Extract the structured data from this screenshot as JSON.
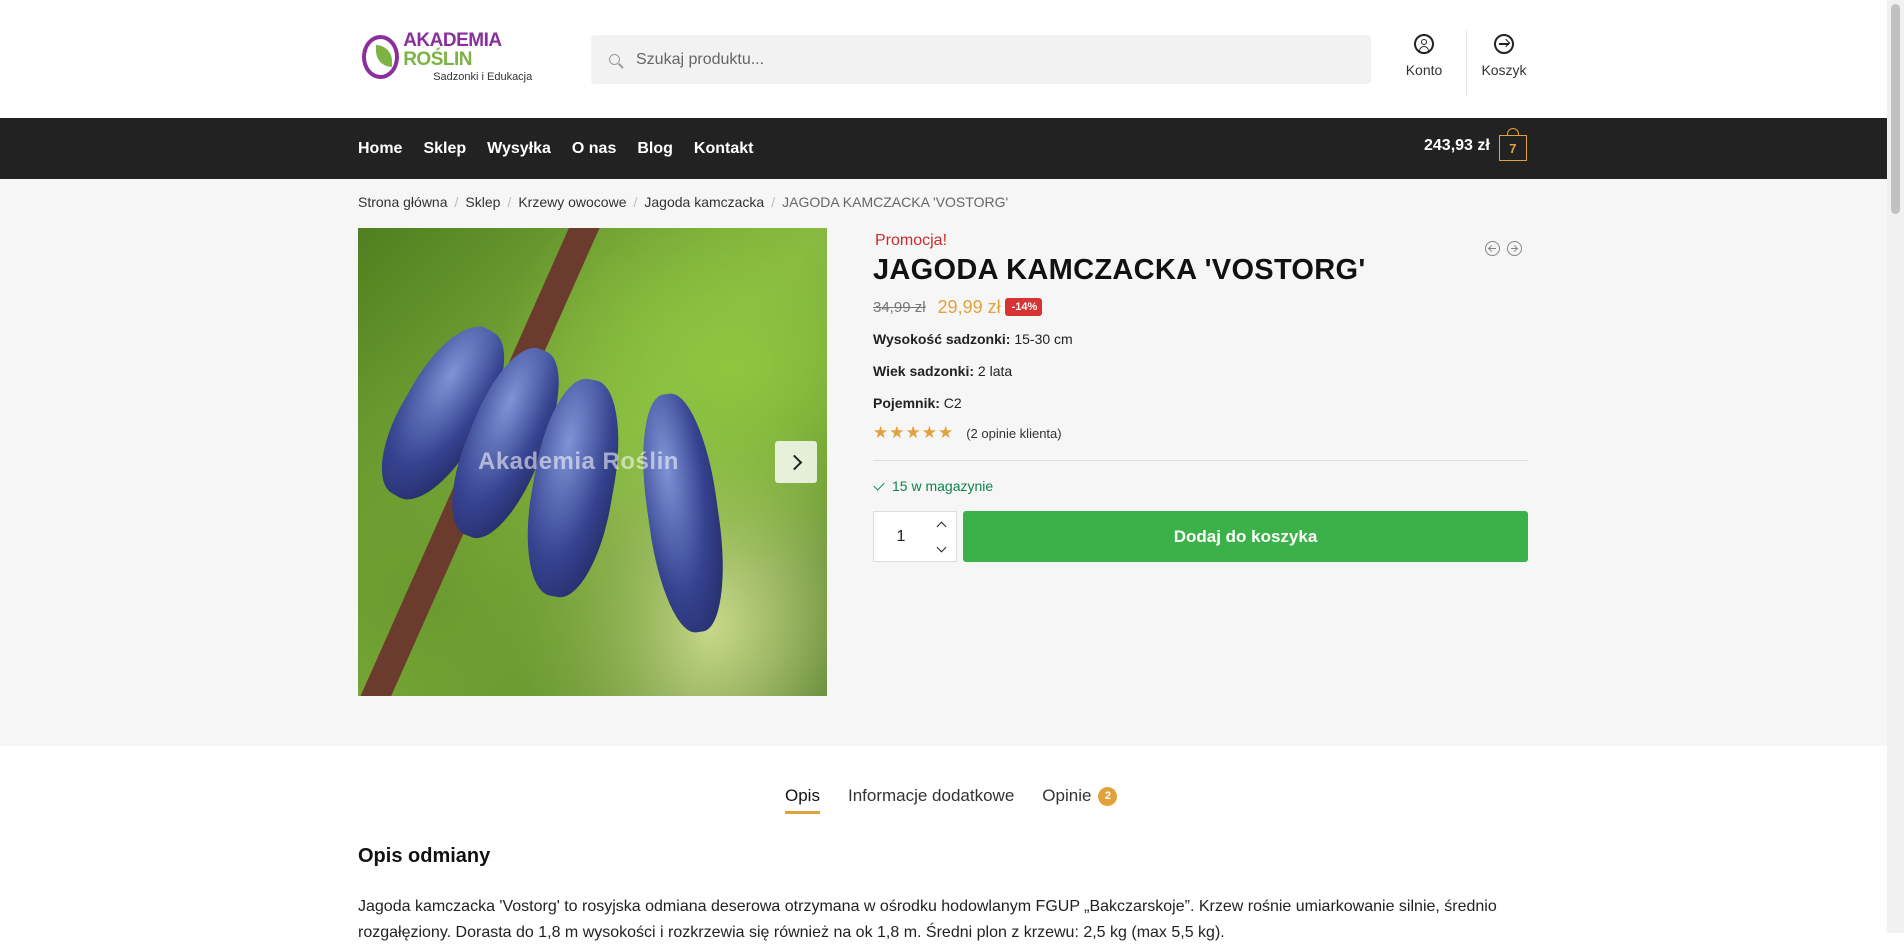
{
  "header": {
    "logo_line1_a": "AKADEMIA",
    "logo_line1_b": "ROŚLIN",
    "logo_line2": "Sadzonki i Edukacja",
    "search_placeholder": "Szukaj produktu...",
    "account_label": "Konto",
    "cart_label": "Koszyk"
  },
  "nav": {
    "items": [
      {
        "label": "Home"
      },
      {
        "label": "Sklep"
      },
      {
        "label": "Wysyłka"
      },
      {
        "label": "O nas"
      },
      {
        "label": "Blog"
      },
      {
        "label": "Kontakt"
      }
    ],
    "cart_total": "243,93 zł",
    "cart_count": "7"
  },
  "breadcrumb": {
    "items": [
      "Strona główna",
      "Sklep",
      "Krzewy owocowe",
      "Jagoda kamczacka"
    ],
    "current": "JAGODA KAMCZACKA 'VOSTORG'"
  },
  "gallery": {
    "watermark": "Akademia Roślin"
  },
  "product": {
    "promo_label": "Promocja!",
    "title": "JAGODA KAMCZACKA 'VOSTORG'",
    "old_price": "34,99 zł",
    "new_price": "29,99 zł",
    "discount": "-14%",
    "attributes": [
      {
        "label": "Wysokość sadzonki:",
        "value": "15-30 cm"
      },
      {
        "label": "Wiek sadzonki:",
        "value": "2 lata"
      },
      {
        "label": "Pojemnik:",
        "value": "C2"
      }
    ],
    "stars": "★★★★★",
    "rating_value": 5,
    "reviews_text": "(2 opinie klienta)",
    "stock": "15 w magazynie",
    "quantity": "1",
    "add_to_cart": "Dodaj do koszyka"
  },
  "tabs": [
    {
      "label": "Opis",
      "active": true
    },
    {
      "label": "Informacje dodatkowe",
      "active": false
    },
    {
      "label": "Opinie",
      "badge": "2",
      "active": false
    }
  ],
  "description": {
    "title": "Opis odmiany",
    "text": "Jagoda kamczacka 'Vostorg' to rosyjska odmiana deserowa otrzymana w ośrodku hodowlanym FGUP „Bakczarskoje”. Krzew rośnie umiarkowanie silnie, średnio rozgałęziony. Dorasta do 1,8 m wysokości i rozkrzewia się również na ok 1,8 m. Średni plon z krzewu: 2,5 kg (max 5,5 kg)."
  },
  "colors": {
    "accent": "#e2a23b",
    "button": "#3bb249",
    "nav_bg": "#222222",
    "promo": "#c92d2d",
    "stock": "#0f834d"
  }
}
